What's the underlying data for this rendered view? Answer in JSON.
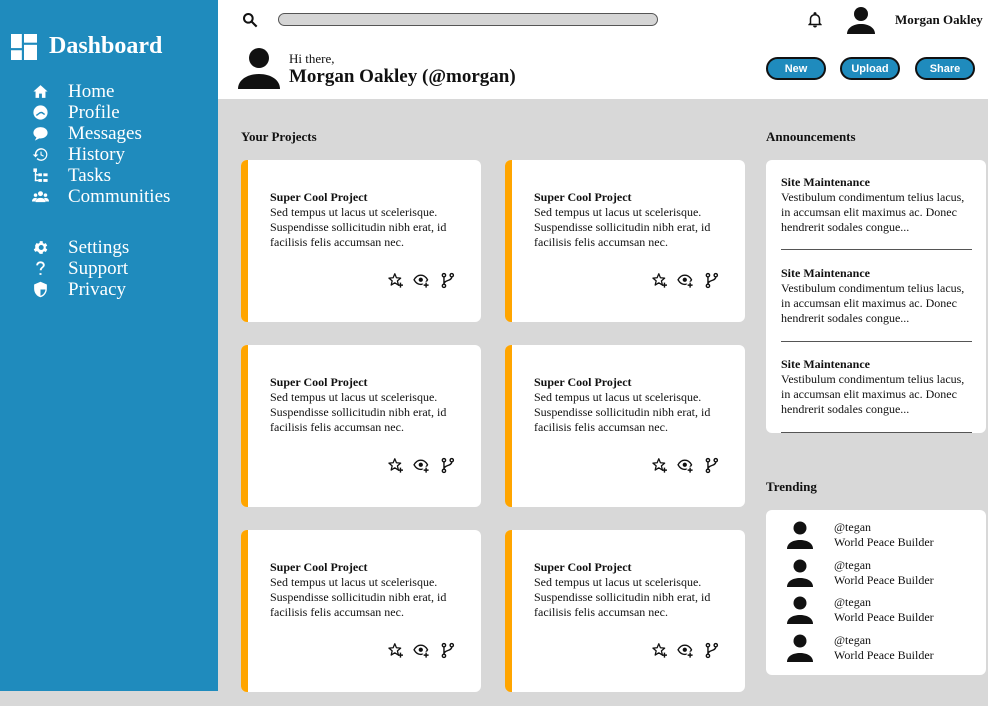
{
  "sidebar": {
    "brand": "Dashboard",
    "nav_primary": [
      {
        "label": "Home",
        "icon": "home-icon"
      },
      {
        "label": "Profile",
        "icon": "profile-icon"
      },
      {
        "label": "Messages",
        "icon": "messages-icon"
      },
      {
        "label": "History",
        "icon": "history-icon"
      },
      {
        "label": "Tasks",
        "icon": "tasks-icon"
      },
      {
        "label": "Communities",
        "icon": "communities-icon"
      }
    ],
    "nav_secondary": [
      {
        "label": "Settings",
        "icon": "settings-icon"
      },
      {
        "label": "Support",
        "icon": "support-icon"
      },
      {
        "label": "Privacy",
        "icon": "privacy-icon"
      }
    ]
  },
  "header": {
    "search_placeholder": "",
    "user_name": "Morgan Oakley",
    "greeting": "Hi there,",
    "user_full": "Morgan Oakley (@morgan)",
    "buttons": {
      "new": "New",
      "upload": "Upload",
      "share": "Share"
    }
  },
  "projects": {
    "title": "Your Projects",
    "cards": [
      {
        "title": "Super Cool Project",
        "text": "Sed tempus ut lacus ut scelerisque. Suspendisse sollicitudin nibh erat, id facilisis felis accumsan nec."
      },
      {
        "title": "Super Cool Project",
        "text": "Sed tempus ut lacus ut scelerisque. Suspendisse sollicitudin nibh erat, id facilisis felis accumsan nec."
      },
      {
        "title": "Super Cool Project",
        "text": "Sed tempus ut lacus ut scelerisque. Suspendisse sollicitudin nibh erat, id facilisis felis accumsan nec."
      },
      {
        "title": "Super Cool Project",
        "text": "Sed tempus ut lacus ut scelerisque. Suspendisse sollicitudin nibh erat, id facilisis felis accumsan nec."
      },
      {
        "title": "Super Cool Project",
        "text": "Sed tempus ut lacus ut scelerisque. Suspendisse sollicitudin nibh erat, id facilisis felis accumsan nec."
      },
      {
        "title": "Super Cool Project",
        "text": "Sed tempus ut lacus ut scelerisque. Suspendisse sollicitudin nibh erat, id facilisis felis accumsan nec."
      }
    ]
  },
  "announcements": {
    "title": "Announcements",
    "items": [
      {
        "title": "Site Maintenance",
        "text": "Vestibulum condimentum telius lacus, in accumsan elit maximus ac. Donec hendrerit sodales congue..."
      },
      {
        "title": "Site Maintenance",
        "text": "Vestibulum condimentum telius lacus, in accumsan elit maximus ac. Donec hendrerit sodales congue..."
      },
      {
        "title": "Site Maintenance",
        "text": "Vestibulum condimentum telius lacus, in accumsan elit maximus ac. Donec hendrerit sodales congue..."
      }
    ]
  },
  "trending": {
    "title": "Trending",
    "items": [
      {
        "handle": "@tegan",
        "role": "World Peace Builder"
      },
      {
        "handle": "@tegan",
        "role": "World Peace Builder"
      },
      {
        "handle": "@tegan",
        "role": "World Peace Builder"
      },
      {
        "handle": "@tegan",
        "role": "World Peace Builder"
      }
    ]
  },
  "colors": {
    "sidebar": "#1f8bbd",
    "accent": "#ffa500",
    "background": "#d8d8d8"
  }
}
